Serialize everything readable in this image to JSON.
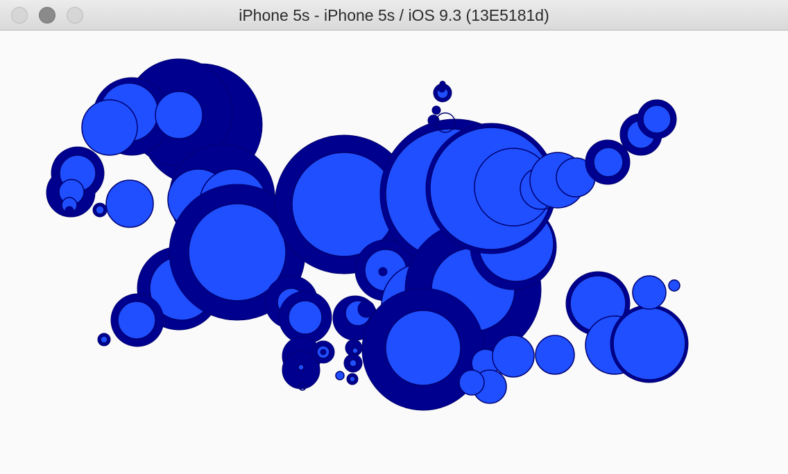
{
  "window": {
    "title": "iPhone 5s - iPhone 5s / iOS 9.3 (13E5181d)"
  },
  "controls": {
    "close": "close-button",
    "minimize": "minimize-button",
    "zoom": "zoom-button"
  },
  "colors": {
    "dark": "#00008f",
    "light": "#1f4fff",
    "stroke": "#000070",
    "background": "#fafafa"
  }
}
